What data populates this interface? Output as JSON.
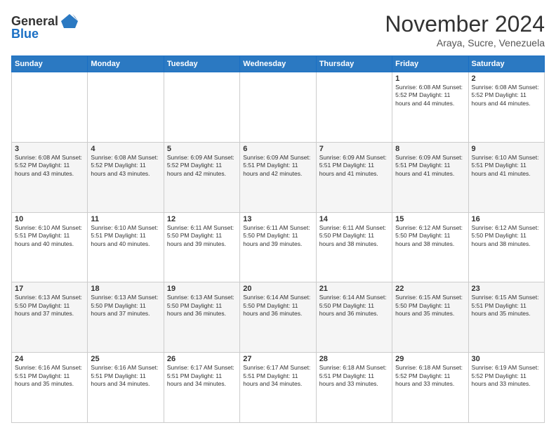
{
  "header": {
    "logo_general": "General",
    "logo_blue": "Blue",
    "month_title": "November 2024",
    "location": "Araya, Sucre, Venezuela"
  },
  "weekdays": [
    "Sunday",
    "Monday",
    "Tuesday",
    "Wednesday",
    "Thursday",
    "Friday",
    "Saturday"
  ],
  "weeks": [
    [
      {
        "day": "",
        "info": ""
      },
      {
        "day": "",
        "info": ""
      },
      {
        "day": "",
        "info": ""
      },
      {
        "day": "",
        "info": ""
      },
      {
        "day": "",
        "info": ""
      },
      {
        "day": "1",
        "info": "Sunrise: 6:08 AM\nSunset: 5:52 PM\nDaylight: 11 hours\nand 44 minutes."
      },
      {
        "day": "2",
        "info": "Sunrise: 6:08 AM\nSunset: 5:52 PM\nDaylight: 11 hours\nand 44 minutes."
      }
    ],
    [
      {
        "day": "3",
        "info": "Sunrise: 6:08 AM\nSunset: 5:52 PM\nDaylight: 11 hours\nand 43 minutes."
      },
      {
        "day": "4",
        "info": "Sunrise: 6:08 AM\nSunset: 5:52 PM\nDaylight: 11 hours\nand 43 minutes."
      },
      {
        "day": "5",
        "info": "Sunrise: 6:09 AM\nSunset: 5:52 PM\nDaylight: 11 hours\nand 42 minutes."
      },
      {
        "day": "6",
        "info": "Sunrise: 6:09 AM\nSunset: 5:51 PM\nDaylight: 11 hours\nand 42 minutes."
      },
      {
        "day": "7",
        "info": "Sunrise: 6:09 AM\nSunset: 5:51 PM\nDaylight: 11 hours\nand 41 minutes."
      },
      {
        "day": "8",
        "info": "Sunrise: 6:09 AM\nSunset: 5:51 PM\nDaylight: 11 hours\nand 41 minutes."
      },
      {
        "day": "9",
        "info": "Sunrise: 6:10 AM\nSunset: 5:51 PM\nDaylight: 11 hours\nand 41 minutes."
      }
    ],
    [
      {
        "day": "10",
        "info": "Sunrise: 6:10 AM\nSunset: 5:51 PM\nDaylight: 11 hours\nand 40 minutes."
      },
      {
        "day": "11",
        "info": "Sunrise: 6:10 AM\nSunset: 5:51 PM\nDaylight: 11 hours\nand 40 minutes."
      },
      {
        "day": "12",
        "info": "Sunrise: 6:11 AM\nSunset: 5:50 PM\nDaylight: 11 hours\nand 39 minutes."
      },
      {
        "day": "13",
        "info": "Sunrise: 6:11 AM\nSunset: 5:50 PM\nDaylight: 11 hours\nand 39 minutes."
      },
      {
        "day": "14",
        "info": "Sunrise: 6:11 AM\nSunset: 5:50 PM\nDaylight: 11 hours\nand 38 minutes."
      },
      {
        "day": "15",
        "info": "Sunrise: 6:12 AM\nSunset: 5:50 PM\nDaylight: 11 hours\nand 38 minutes."
      },
      {
        "day": "16",
        "info": "Sunrise: 6:12 AM\nSunset: 5:50 PM\nDaylight: 11 hours\nand 38 minutes."
      }
    ],
    [
      {
        "day": "17",
        "info": "Sunrise: 6:13 AM\nSunset: 5:50 PM\nDaylight: 11 hours\nand 37 minutes."
      },
      {
        "day": "18",
        "info": "Sunrise: 6:13 AM\nSunset: 5:50 PM\nDaylight: 11 hours\nand 37 minutes."
      },
      {
        "day": "19",
        "info": "Sunrise: 6:13 AM\nSunset: 5:50 PM\nDaylight: 11 hours\nand 36 minutes."
      },
      {
        "day": "20",
        "info": "Sunrise: 6:14 AM\nSunset: 5:50 PM\nDaylight: 11 hours\nand 36 minutes."
      },
      {
        "day": "21",
        "info": "Sunrise: 6:14 AM\nSunset: 5:50 PM\nDaylight: 11 hours\nand 36 minutes."
      },
      {
        "day": "22",
        "info": "Sunrise: 6:15 AM\nSunset: 5:50 PM\nDaylight: 11 hours\nand 35 minutes."
      },
      {
        "day": "23",
        "info": "Sunrise: 6:15 AM\nSunset: 5:51 PM\nDaylight: 11 hours\nand 35 minutes."
      }
    ],
    [
      {
        "day": "24",
        "info": "Sunrise: 6:16 AM\nSunset: 5:51 PM\nDaylight: 11 hours\nand 35 minutes."
      },
      {
        "day": "25",
        "info": "Sunrise: 6:16 AM\nSunset: 5:51 PM\nDaylight: 11 hours\nand 34 minutes."
      },
      {
        "day": "26",
        "info": "Sunrise: 6:17 AM\nSunset: 5:51 PM\nDaylight: 11 hours\nand 34 minutes."
      },
      {
        "day": "27",
        "info": "Sunrise: 6:17 AM\nSunset: 5:51 PM\nDaylight: 11 hours\nand 34 minutes."
      },
      {
        "day": "28",
        "info": "Sunrise: 6:18 AM\nSunset: 5:51 PM\nDaylight: 11 hours\nand 33 minutes."
      },
      {
        "day": "29",
        "info": "Sunrise: 6:18 AM\nSunset: 5:52 PM\nDaylight: 11 hours\nand 33 minutes."
      },
      {
        "day": "30",
        "info": "Sunrise: 6:19 AM\nSunset: 5:52 PM\nDaylight: 11 hours\nand 33 minutes."
      }
    ]
  ]
}
